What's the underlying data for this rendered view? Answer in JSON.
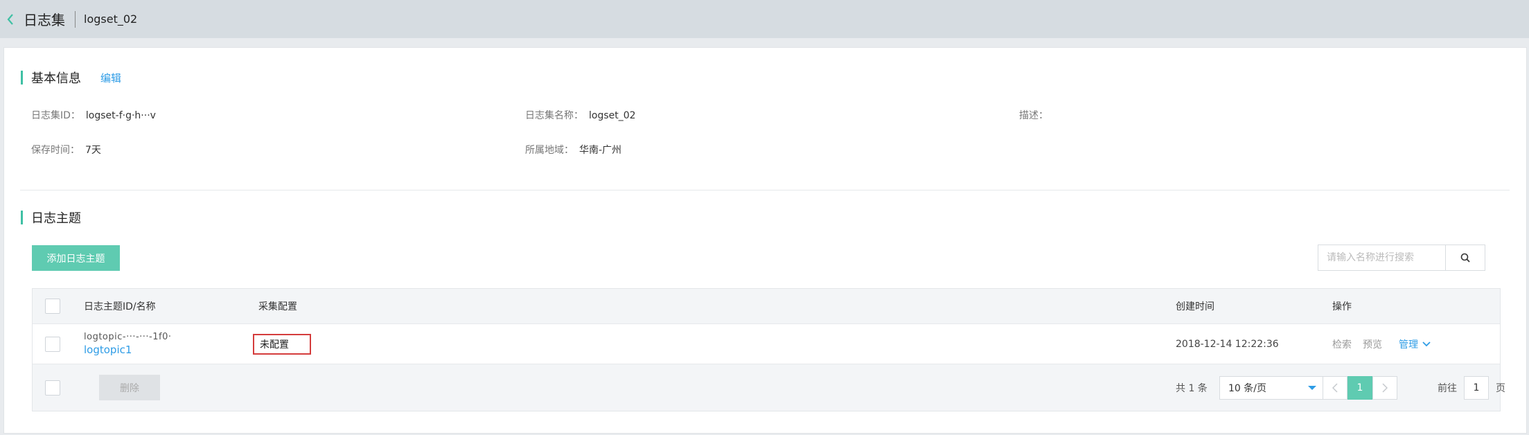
{
  "header": {
    "title": "日志集",
    "subtitle": "logset_02"
  },
  "basic_info": {
    "section_title": "基本信息",
    "edit_label": "编辑",
    "fields": {
      "logset_id_label": "日志集ID：",
      "logset_id_value": "logset-f·g·h···v",
      "logset_name_label": "日志集名称：",
      "logset_name_value": "logset_02",
      "desc_label": "描述：",
      "desc_value": "",
      "retention_label": "保存时间：",
      "retention_value": "7天",
      "region_label": "所属地域：",
      "region_value": "华南-广州"
    }
  },
  "topics": {
    "section_title": "日志主题",
    "add_button": "添加日志主题",
    "search_placeholder": "请输入名称进行搜索",
    "columns": {
      "id_name": "日志主题ID/名称",
      "collect": "采集配置",
      "created": "创建时间",
      "ops": "操作"
    },
    "rows": [
      {
        "topic_id": "logtopic-···-···-1f0·",
        "topic_name": "logtopic1",
        "collect": "未配置",
        "created": "2018-12-14 12:22:36",
        "op_search": "检索",
        "op_preview": "预览",
        "op_manage": "管理"
      }
    ],
    "footer": {
      "delete_label": "删除",
      "total_text": "共 1 条",
      "page_size": "10 条/页",
      "current_page": "1",
      "goto_label": "前往",
      "goto_value": "1",
      "page_unit": "页"
    }
  },
  "colors": {
    "accent": "#5fcbb1",
    "link": "#2e9ce6",
    "highlight_border": "#d43c3c"
  }
}
